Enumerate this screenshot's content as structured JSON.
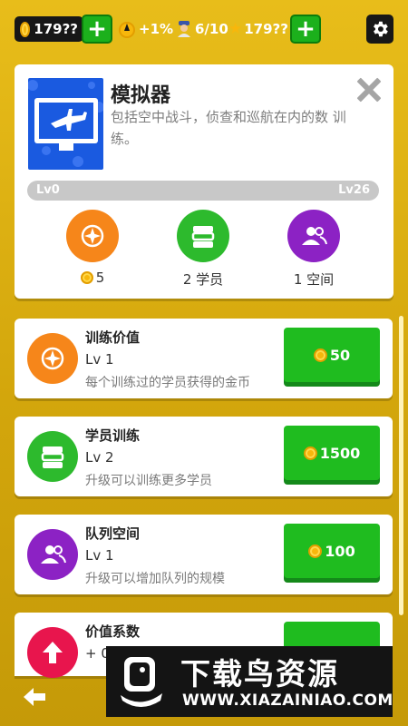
{
  "topbar": {
    "coins": "179??",
    "boost": "+1%",
    "crew": "6/10",
    "stars": "179??"
  },
  "facility": {
    "title": "模拟器",
    "description": "包括空中战斗，侦查和巡航在内的数 训练。",
    "level_min": "Lv0",
    "level_max": "Lv26",
    "level_progress": 0,
    "stats": [
      {
        "label": "5",
        "icon": "target-icon",
        "color": "#f6861a"
      },
      {
        "label": "2 学员",
        "icon": "stack-icon",
        "color": "#2dba2d"
      },
      {
        "label": "1 空间",
        "icon": "group-icon",
        "color": "#8c22c4"
      }
    ]
  },
  "upgrades": [
    {
      "title": "训练价值",
      "level": "Lv 1",
      "desc": "每个训练过的学员获得的金币",
      "price": "50",
      "icon": "target-icon",
      "color": "#f6861a"
    },
    {
      "title": "学员训练",
      "level": "Lv 2",
      "desc": "升级可以训练更多学员",
      "price": "1500",
      "icon": "stack-icon",
      "color": "#2dba2d"
    },
    {
      "title": "队列空间",
      "level": "Lv 1",
      "desc": "升级可以增加队列的规模",
      "price": "100",
      "icon": "group-icon",
      "color": "#8c22c4"
    },
    {
      "title": "价值系数",
      "level": "+ 0%",
      "desc": "",
      "price": "",
      "icon": "arrow-up-icon",
      "color": "#e8154d"
    }
  ],
  "watermark": {
    "name": "下载鸟资源",
    "url": "WWW.XIAZAINIAO.COM"
  },
  "colors": {
    "background": "#dcae12",
    "buy_button": "#1fbc1f",
    "plus_button": "#1cb01c"
  }
}
